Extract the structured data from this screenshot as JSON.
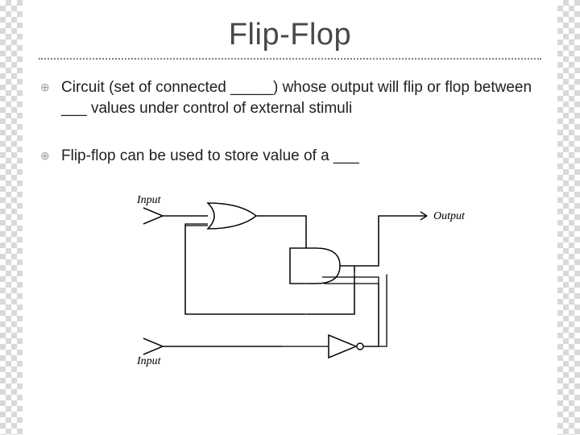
{
  "title": "Flip-Flop",
  "bullets": [
    "Circuit (set of connected _____) whose output will flip or flop between ___ values under control of external stimuli",
    "Flip-flop can be used to store value of a ___"
  ],
  "diagram": {
    "input_top": "Input",
    "input_bottom": "Input",
    "output": "Output"
  }
}
